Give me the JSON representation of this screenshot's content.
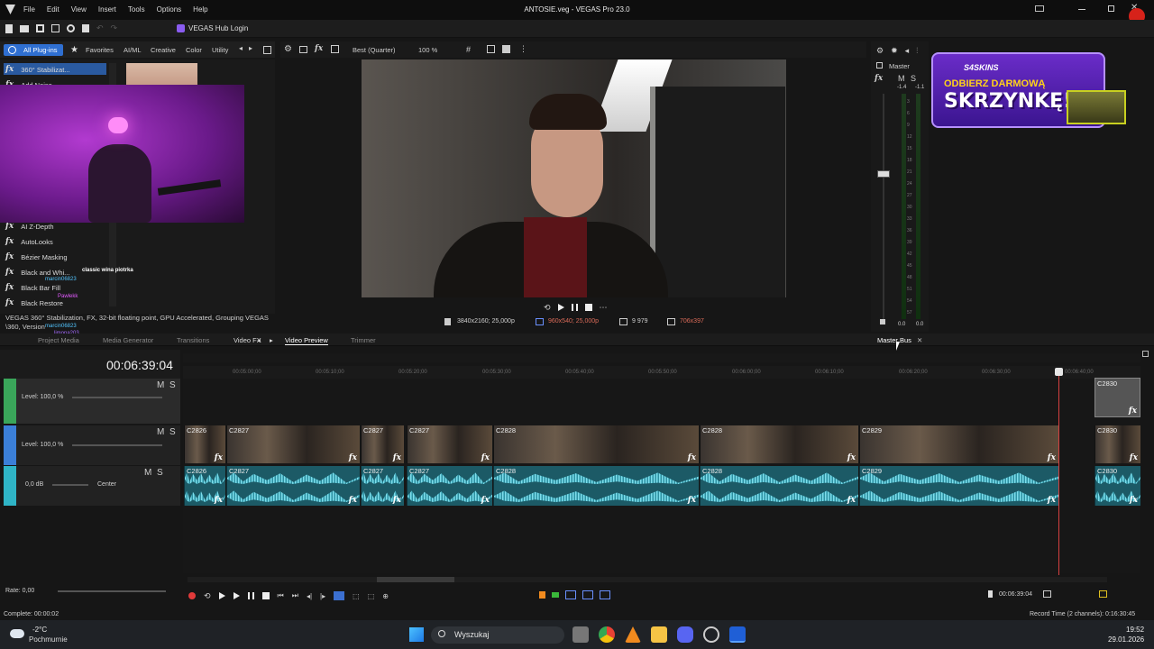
{
  "app": {
    "title": "ANTOSIE.veg - VEGAS Pro 23.0",
    "menu": [
      "File",
      "Edit",
      "View",
      "Insert",
      "Tools",
      "Options",
      "Help"
    ],
    "hub_login": "VEGAS Hub Login"
  },
  "plugins": {
    "tabs": [
      "All Plug-ins",
      "Favorites",
      "AI/ML",
      "Creative",
      "Color",
      "Utility"
    ],
    "items": [
      "360° Stabilizat...",
      "Add Noise",
      "AI Z-Depth",
      "AutoLooks",
      "Bézier Masking",
      "Black and Whi...",
      "Black Bar Fill",
      "Black Restore"
    ],
    "description_line1": "VEGAS 360° Stabilization, FX, 32-bit floating point, GPU Accelerated, Grouping VEGAS",
    "description_line2": "\\360, Version"
  },
  "chat_overlay": [
    "classic wina piotrka",
    "marcin06823",
    "Pawlekk",
    "marcin06823",
    "marcin06823",
    "limona203"
  ],
  "preview": {
    "quality": "Best (Quarter)",
    "zoom": "100 %",
    "project_res": "3840x2160; 25,000p",
    "preview_res": "960x540; 25,000p",
    "frame": "9 979",
    "display_res": "706x397"
  },
  "window_tabs": [
    "Project Media",
    "Media Generator",
    "Transitions",
    "Video FX",
    "Video Preview",
    "Trimmer",
    "Master Bus"
  ],
  "mixer": {
    "title": "Master",
    "labels": [
      "M",
      "S"
    ],
    "levels": [
      "-1.4",
      "-1.1"
    ],
    "bottom": [
      "0.0",
      "0.0"
    ],
    "scale": [
      "3",
      "6",
      "9",
      "12",
      "15",
      "18",
      "21",
      "24",
      "27",
      "30",
      "33",
      "36",
      "39",
      "42",
      "45",
      "48",
      "51",
      "54",
      "57"
    ]
  },
  "promo": {
    "brand": "S4SKINS",
    "line1": "ODBIERZ DARMOWĄ",
    "line2": "SKRZYNKĘ!"
  },
  "timeline": {
    "timecode": "00:06:39:04",
    "ruler": [
      "00:05:00;00",
      "00:05:10;00",
      "00:05:20;00",
      "00:05:30;00",
      "00:05:40;00",
      "00:05:50;00",
      "00:06:00;00",
      "00:06:10;00",
      "00:06:20;00",
      "00:06:30;00",
      "00:06:40;00"
    ],
    "tracks": [
      {
        "level": "Level: 100,0 %",
        "m": "M",
        "s": "S"
      },
      {
        "level": "Level: 100,0 %",
        "m": "M",
        "s": "S"
      },
      {
        "vol": "0,0 dB",
        "pan": "Center",
        "m": "M",
        "s": "S"
      }
    ],
    "video_clips": [
      "C2826",
      "C2827",
      "C2827",
      "C2827",
      "C2828",
      "C2828",
      "C2829",
      "C2830"
    ],
    "audio_clips": [
      "C2826",
      "C2827",
      "C2827",
      "C2827",
      "C2828",
      "C2828",
      "C2829",
      "C2830"
    ],
    "top_clip": "C2830",
    "rate": "Rate: 0,00",
    "end_time": "00:06:39:04"
  },
  "status": {
    "left": "Complete: 00:00:02",
    "right": "Record Time (2 channels): 0:16:30:45"
  },
  "taskbar": {
    "weather_temp": "-2°C",
    "weather_desc": "Pochmurnie",
    "search": "Wyszukaj",
    "time": "19:52",
    "date": "29.01.2026"
  }
}
